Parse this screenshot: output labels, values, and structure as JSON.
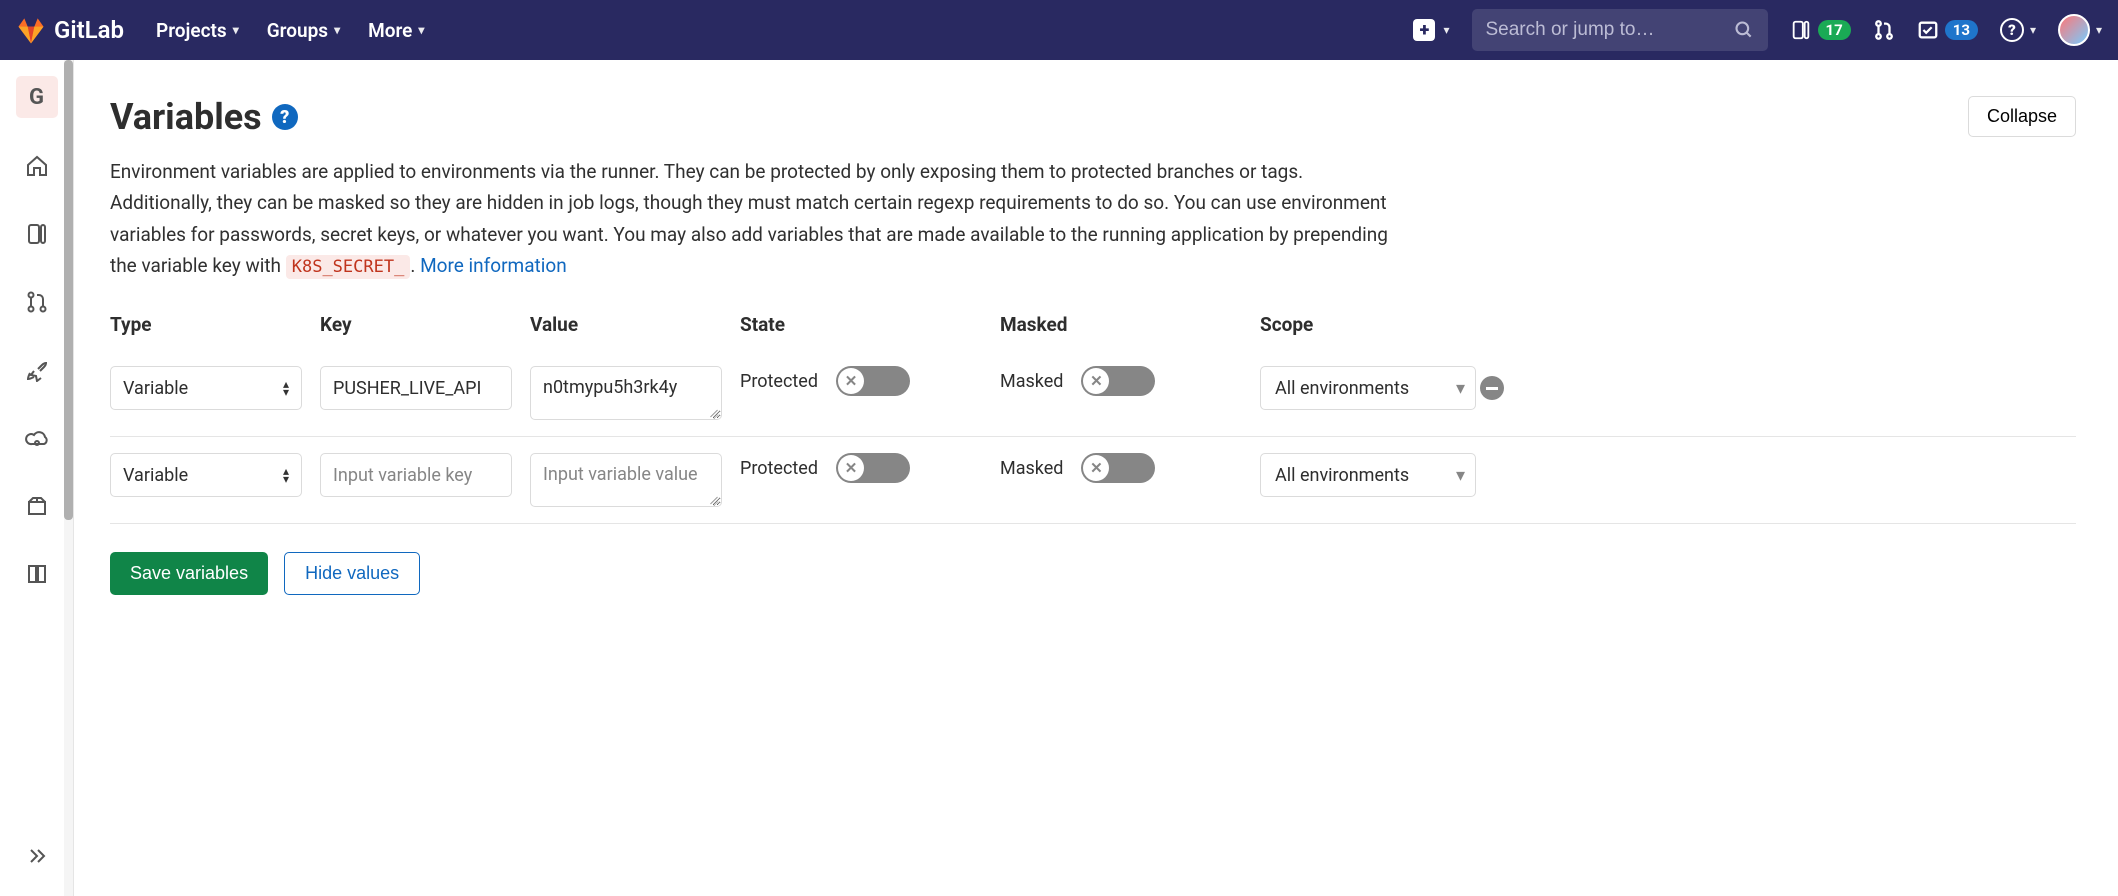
{
  "header": {
    "brand": "GitLab",
    "nav": {
      "projects": "Projects",
      "groups": "Groups",
      "more": "More"
    },
    "search_placeholder": "Search or jump to…",
    "issues_count": "17",
    "todos_count": "13"
  },
  "sidebar": {
    "project_letter": "G"
  },
  "main": {
    "title": "Variables",
    "collapse": "Collapse",
    "description_1": "Environment variables are applied to environments via the runner. They can be protected by only exposing them to protected branches or tags. Additionally, they can be masked so they are hidden in job logs, though they must match certain regexp requirements to do so. You can use environment variables for passwords, secret keys, or whatever you want. You may also add variables that are made available to the running application by prepending the variable key with ",
    "code_chip": "K8S_SECRET_",
    "more_info": "More information",
    "columns": {
      "type": "Type",
      "key": "Key",
      "value": "Value",
      "state": "State",
      "masked": "Masked",
      "scope": "Scope"
    },
    "rows": [
      {
        "type_option": "Variable",
        "key": "PUSHER_LIVE_API",
        "value": "n0tmypu5h3rk4y",
        "state_label": "Protected",
        "masked_label": "Masked",
        "scope": "All environments",
        "has_remove": true
      },
      {
        "type_option": "Variable",
        "key_placeholder": "Input variable key",
        "value_placeholder": "Input variable value",
        "state_label": "Protected",
        "masked_label": "Masked",
        "scope": "All environments",
        "has_remove": false
      }
    ],
    "save_btn": "Save variables",
    "hide_btn": "Hide values"
  }
}
